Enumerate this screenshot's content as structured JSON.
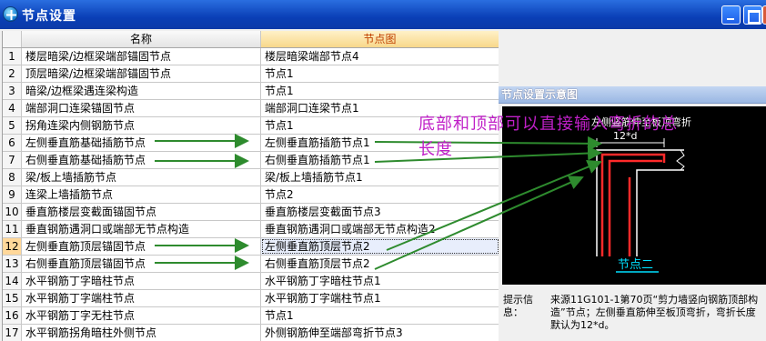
{
  "window": {
    "title": "节点设置"
  },
  "table": {
    "headers": {
      "name": "名称",
      "node": "节点图"
    },
    "rows": [
      {
        "num": "1",
        "name": "楼层暗梁/边框梁端部锚固节点",
        "node": "楼层暗梁端部节点4"
      },
      {
        "num": "2",
        "name": "顶层暗梁/边框梁端部锚固节点",
        "node": "节点1"
      },
      {
        "num": "3",
        "name": "暗梁/边框梁遇连梁构造",
        "node": "节点1"
      },
      {
        "num": "4",
        "name": "端部洞口连梁锚固节点",
        "node": "端部洞口连梁节点1"
      },
      {
        "num": "5",
        "name": "拐角连梁内侧钢筋节点",
        "node": "节点1"
      },
      {
        "num": "6",
        "name": "左侧垂直筋基础插筋节点",
        "node": "左侧垂直筋插筋节点1"
      },
      {
        "num": "7",
        "name": "右侧垂直筋基础插筋节点",
        "node": "右侧垂直筋插筋节点1"
      },
      {
        "num": "8",
        "name": "梁/板上墙插筋节点",
        "node": "梁/板上墙插筋节点1"
      },
      {
        "num": "9",
        "name": "连梁上墙插筋节点",
        "node": "节点2"
      },
      {
        "num": "10",
        "name": "垂直筋楼层变截面锚固节点",
        "node": "垂直筋楼层变截面节点3"
      },
      {
        "num": "11",
        "name": "垂直钢筋遇洞口或端部无节点构造",
        "node": "垂直钢筋遇洞口或端部无节点构造2"
      },
      {
        "num": "12",
        "name": "左侧垂直筋顶层锚固节点",
        "node": "左侧垂直筋顶层节点2",
        "selected": true
      },
      {
        "num": "13",
        "name": "右侧垂直筋顶层锚固节点",
        "node": "右侧垂直筋顶层节点2"
      },
      {
        "num": "14",
        "name": "水平钢筋丁字暗柱节点",
        "node": "水平钢筋丁字暗柱节点1"
      },
      {
        "num": "15",
        "name": "水平钢筋丁字端柱节点",
        "node": "水平钢筋丁字端柱节点1"
      },
      {
        "num": "16",
        "name": "水平钢筋丁字无柱节点",
        "node": "节点1"
      },
      {
        "num": "17",
        "name": "水平钢筋拐角暗柱外侧节点",
        "node": "外侧钢筋伸至端部弯折节点3"
      }
    ]
  },
  "preview": {
    "title": "节点设置示意图",
    "diagram_caption": "左侧竖筋伸至板顶弯折",
    "dimension_label": "12*d",
    "node_name": "节点二"
  },
  "hint": {
    "label": "提示信息：",
    "text": "来源11G101-1第70页“剪力墙竖向钢筋顶部构造”节点；左侧垂直筋伸至板顶弯折，弯折长度默认为12*d。"
  },
  "annotation": {
    "line1": "底部和顶部可以直接输入弯折的总",
    "line2": "长度"
  },
  "colors": {
    "arrow": "#2e8b2e",
    "annotation": "#c020c8",
    "rebar": "#ff2a2a",
    "dimension": "#00e0ff"
  }
}
